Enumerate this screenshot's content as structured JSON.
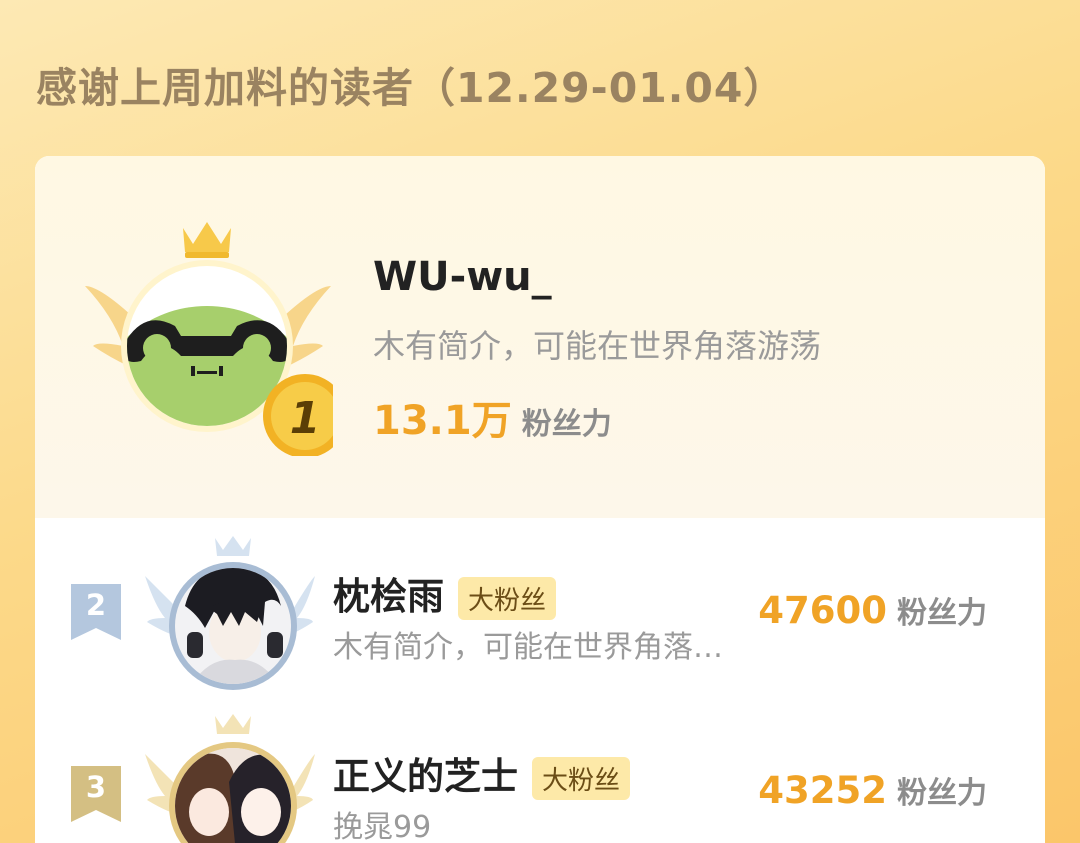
{
  "header": {
    "title": "感谢上周加料的读者（12.29-01.04）"
  },
  "first_place": {
    "rank": "1",
    "name": "WU-wu_",
    "bio": "木有简介，可能在世界角落游荡",
    "score": "13.1万",
    "score_unit": "粉丝力",
    "avatar_icon": "frog-avatar-icon"
  },
  "ranking": [
    {
      "rank": "2",
      "name": "枕桧雨",
      "tag": "大粉丝",
      "bio": "木有简介，可能在世界角落游荡",
      "score": "47600",
      "score_unit": "粉丝力",
      "avatar_icon": "anime-boy-avatar-icon"
    },
    {
      "rank": "3",
      "name": "正义的芝士",
      "tag": "大粉丝",
      "bio": "挽晁99",
      "score": "43252",
      "score_unit": "粉丝力",
      "avatar_icon": "anime-couple-avatar-icon"
    }
  ],
  "colors": {
    "accent": "#f0a326",
    "title": "#9a8361",
    "tag_bg": "#fde9a8"
  }
}
